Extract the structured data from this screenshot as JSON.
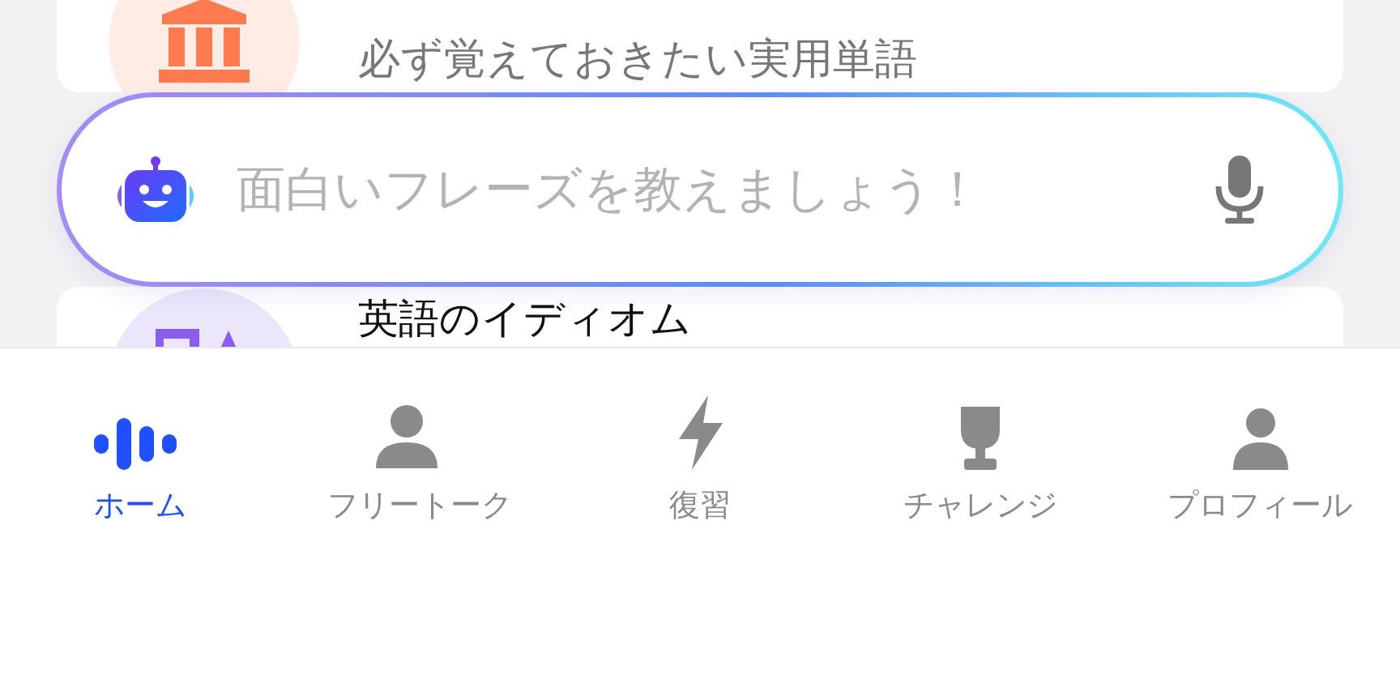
{
  "cards": [
    {
      "subtitle": "必ず覚えておきたい実用単語"
    },
    {
      "title": "英語のイディオム"
    }
  ],
  "search": {
    "placeholder": "面白いフレーズを教えましょう！"
  },
  "tabs": [
    {
      "label": "ホーム",
      "selected": true
    },
    {
      "label": "フリートーク",
      "selected": false
    },
    {
      "label": "復習",
      "selected": false
    },
    {
      "label": "チャレンジ",
      "selected": false
    },
    {
      "label": "プロフィール",
      "selected": false
    }
  ]
}
